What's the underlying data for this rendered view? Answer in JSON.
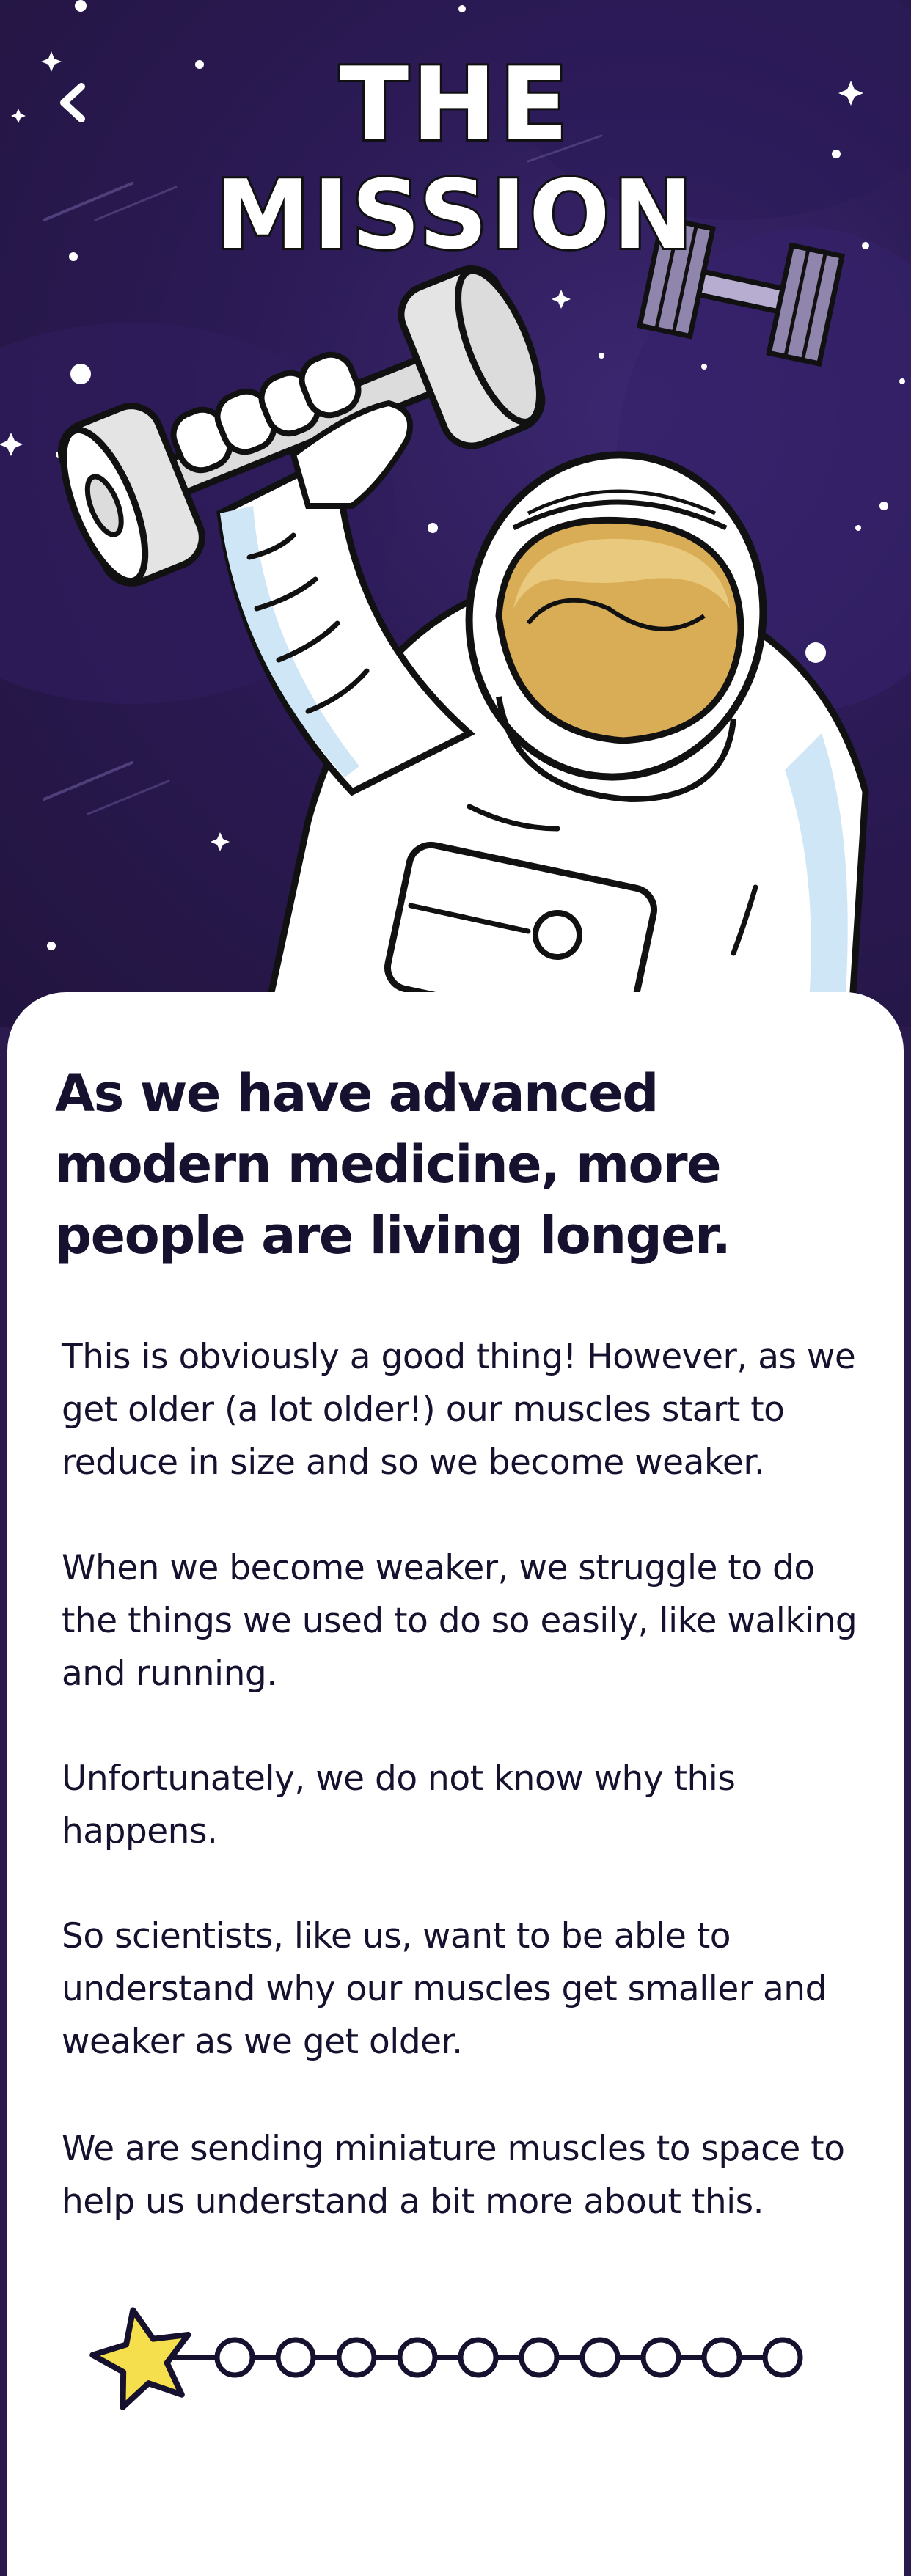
{
  "header": {
    "back_icon": "chevron-left-icon",
    "title_line1": "THE",
    "title_line2": "MISSION"
  },
  "illustration": {
    "subject": "astronaut lifting dumbbell",
    "icons": [
      "astronaut-icon",
      "dumbbell-icon",
      "satellite-icon",
      "star-icon"
    ]
  },
  "content": {
    "headline": "As we have advanced modern medicine, more people are living longer.",
    "paragraphs": [
      "This is obviously a good thing! However, as we get older (a lot older!) our muscles start to reduce in size and so we become weaker.",
      "When we become weaker, we struggle to do the things we used to do so easily, like walking and running.",
      "Unfortunately, we do not know why this happens.",
      "So scientists, like us, want to be able to understand why our muscles get smaller and weaker as we get older.",
      "We are sending miniature muscles to space to help us understand a bit more about this."
    ]
  },
  "progress": {
    "current_step": 1,
    "total_steps": 11,
    "active_icon": "star-icon"
  },
  "colors": {
    "background": "#2a1a4e",
    "card": "#ffffff",
    "text": "#15112e",
    "star": "#f6df4c",
    "visor": "#d9ad55"
  }
}
